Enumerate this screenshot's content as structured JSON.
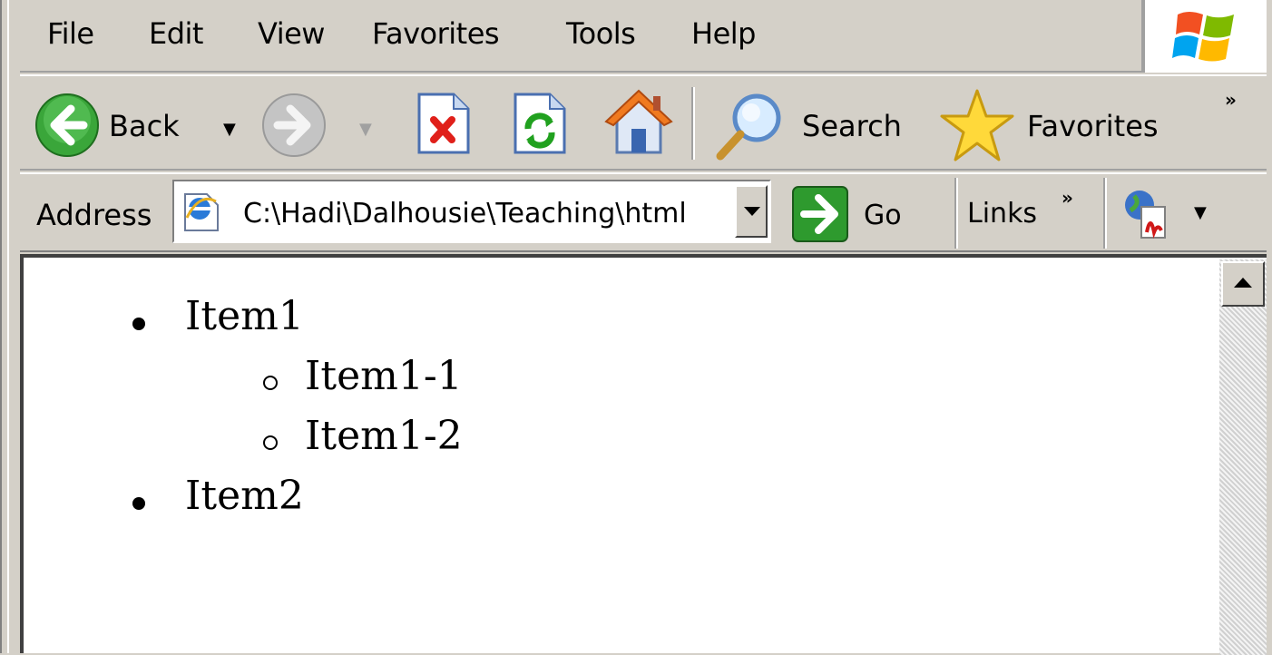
{
  "menu": {
    "file": "File",
    "edit": "Edit",
    "view": "View",
    "favorites": "Favorites",
    "tools": "Tools",
    "help": "Help"
  },
  "toolbar": {
    "back_label": "Back",
    "search_label": "Search",
    "favorites_label": "Favorites",
    "more": "»"
  },
  "addressbar": {
    "label": "Address",
    "value": "C:\\Hadi\\Dalhousie\\Teaching\\html",
    "go_label": "Go",
    "links_label": "Links",
    "links_more": "»"
  },
  "content": {
    "items": [
      {
        "label": "Item1",
        "children": [
          "Item1-1",
          "Item1-2"
        ]
      },
      {
        "label": "Item2",
        "children": []
      }
    ]
  },
  "colors": {
    "chrome": "#d4d0c8",
    "go_green": "#2e9a2e",
    "back_green": "#3aa63a"
  }
}
